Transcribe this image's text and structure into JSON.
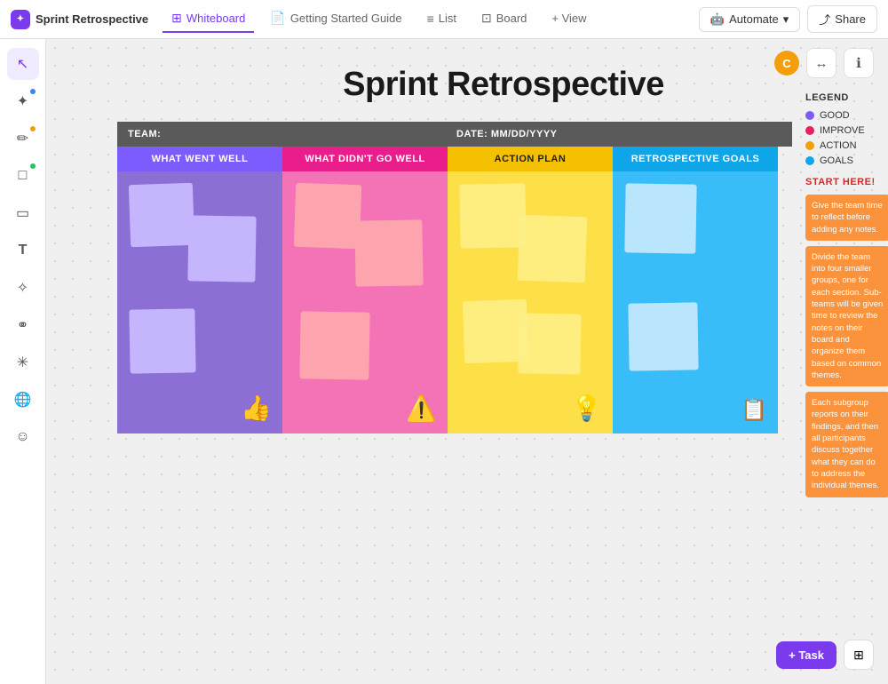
{
  "app": {
    "title": "Sprint Retrospective",
    "logo_icon": "✦"
  },
  "nav": {
    "tabs": [
      {
        "id": "whiteboard",
        "label": "Whiteboard",
        "icon": "⊞",
        "active": true
      },
      {
        "id": "getting-started",
        "label": "Getting Started Guide",
        "icon": "📄",
        "active": false
      },
      {
        "id": "list",
        "label": "List",
        "icon": "≡",
        "active": false
      },
      {
        "id": "board",
        "label": "Board",
        "icon": "⊡",
        "active": false
      },
      {
        "id": "view",
        "label": "+ View",
        "icon": "",
        "active": false
      }
    ],
    "automate_label": "Automate",
    "share_label": "Share"
  },
  "sidebar": {
    "tools": [
      {
        "id": "cursor",
        "icon": "↖",
        "active": true
      },
      {
        "id": "magic",
        "icon": "✦",
        "dot": "blue"
      },
      {
        "id": "pen",
        "icon": "✏",
        "dot": "orange"
      },
      {
        "id": "shape",
        "icon": "□",
        "dot": "green"
      },
      {
        "id": "sticky",
        "icon": "▭"
      },
      {
        "id": "text",
        "icon": "T"
      },
      {
        "id": "sparkle",
        "icon": "✧"
      },
      {
        "id": "org",
        "icon": "⚭"
      },
      {
        "id": "connect",
        "icon": "✳"
      },
      {
        "id": "globe",
        "icon": "🌐"
      },
      {
        "id": "face",
        "icon": "☺"
      }
    ]
  },
  "whiteboard": {
    "title": "Sprint Retrospective",
    "team_label": "TEAM:",
    "date_label": "DATE: MM/DD/YYYY",
    "columns": [
      {
        "id": "went-well",
        "label": "WHAT WENT WELL",
        "color": "purple",
        "icon": "👍"
      },
      {
        "id": "didnt-go-well",
        "label": "WHAT DIDN'T GO WELL",
        "color": "pink",
        "icon": "⚠️"
      },
      {
        "id": "action-plan",
        "label": "ACTION PLAN",
        "color": "yellow",
        "icon": "💡"
      },
      {
        "id": "retro-goals",
        "label": "RETROSPECTIVE GOALS",
        "color": "blue",
        "icon": "📋"
      }
    ],
    "legend": {
      "title": "LEGEND",
      "items": [
        {
          "label": "GOOD",
          "color": "purple"
        },
        {
          "label": "IMPROVE",
          "color": "pink"
        },
        {
          "label": "ACTION",
          "color": "yellow"
        },
        {
          "label": "GOALS",
          "color": "blue"
        }
      ]
    },
    "start_here": "START HERE!",
    "instructions": [
      "Give the team time to reflect before adding any notes.",
      "Divide the team into four smaller groups, one for each section. Sub-teams will be given time to review the notes on their board and organize them based on common themes.",
      "Each subgroup reports on their findings, and then all participants discuss together what they can do to address the individual themes."
    ]
  },
  "bottom": {
    "task_label": "+ Task",
    "apps_icon": "⊞"
  }
}
